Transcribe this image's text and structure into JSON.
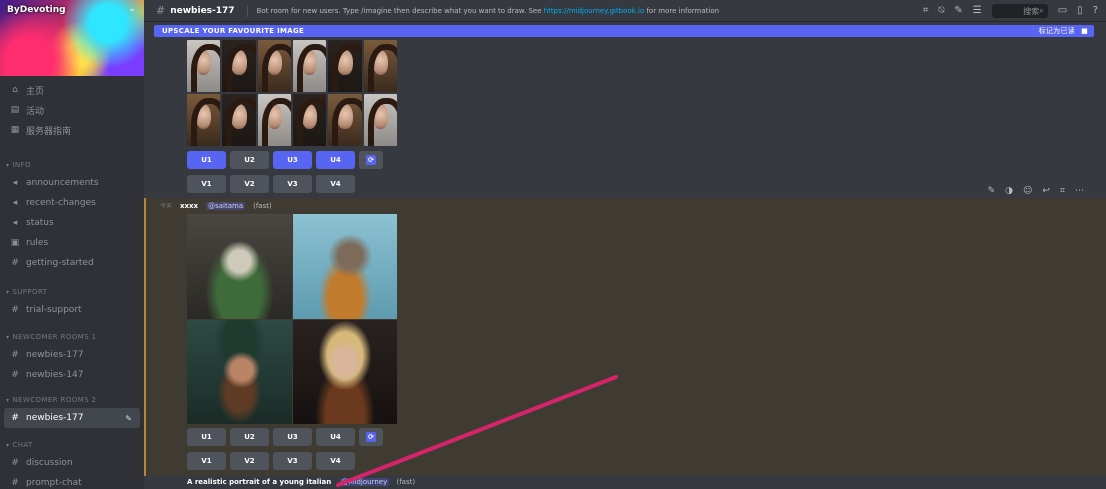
{
  "server": {
    "name": "ByDevoting"
  },
  "sidebar": {
    "top_items": [
      {
        "icon": "home-icon",
        "label": "主页"
      },
      {
        "icon": "list-icon",
        "label": "活动"
      },
      {
        "icon": "calendar-icon",
        "label": "服务器指南"
      }
    ],
    "categories": [
      {
        "label": "info",
        "items": [
          {
            "label": "announcements"
          },
          {
            "label": "recent-changes"
          },
          {
            "label": "status"
          },
          {
            "label": "rules"
          },
          {
            "label": "getting-started"
          }
        ]
      },
      {
        "label": "support",
        "items": [
          {
            "label": "trial-support"
          }
        ]
      },
      {
        "label": "newcomer rooms 1",
        "items": [
          {
            "label": "newbies-177"
          },
          {
            "label": "newbies-147"
          }
        ]
      },
      {
        "label": "newcomer rooms 2",
        "items": [
          {
            "label": "newbies-177",
            "active": true
          }
        ]
      },
      {
        "label": "chat",
        "items": [
          {
            "label": "discussion"
          },
          {
            "label": "prompt-chat"
          }
        ]
      }
    ]
  },
  "header": {
    "channel": "newbies-177",
    "topic_prefix": "Bot room for new users. Type /imagine then describe what you want to draw. See ",
    "topic_link": "https://midjourney.gitbook.io",
    "topic_suffix": " for more information",
    "search_placeholder": "搜索"
  },
  "notice": {
    "text": "UPSCALE YOUR FAVOURITE IMAGE",
    "right": "标记为已读"
  },
  "upscale_rows_top": {
    "upscale": [
      "U1",
      "U2",
      "U3",
      "U4"
    ],
    "variation": [
      "V1",
      "V2",
      "V3",
      "V4"
    ]
  },
  "upscale_rows_bottom": {
    "upscale": [
      "U1",
      "U2",
      "U3",
      "U4"
    ],
    "variation": [
      "V1",
      "V2",
      "V3",
      "V4"
    ]
  },
  "message": {
    "time": "今天",
    "author": "xxxx",
    "mention": "@saitama",
    "mode": "(fast)"
  },
  "bottom_message": {
    "prompt": "A realistic portrait of a young italian",
    "mention": "@Midjourney",
    "mode": "(fast)"
  },
  "colors": {
    "accent": "#5865f2",
    "sidebar": "#2f3136",
    "main": "#36393f",
    "highlight": "#3f3b33",
    "highlight_border": "#b8863b",
    "annotation_arrow": "#d6246b"
  }
}
